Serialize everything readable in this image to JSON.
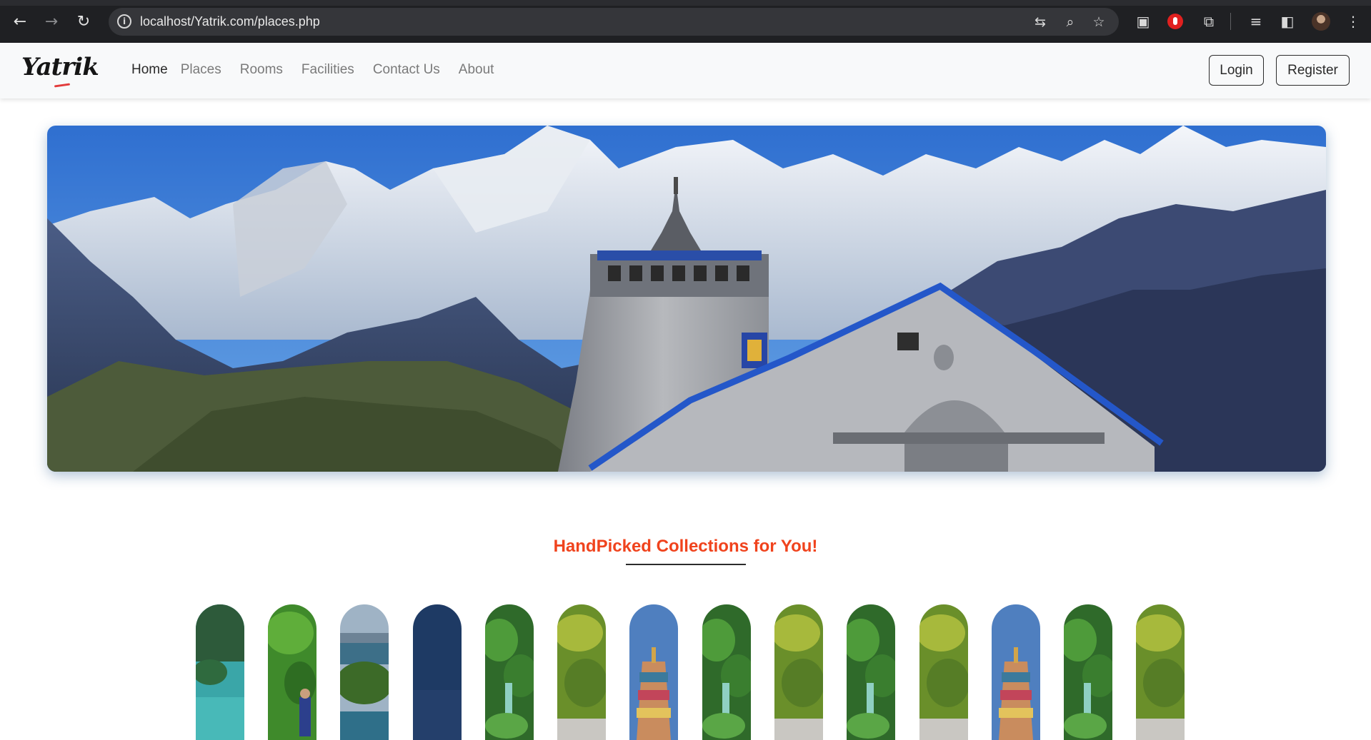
{
  "browser": {
    "url": "localhost/Yatrik.com/places.php",
    "icons": [
      "back-arrow-icon",
      "forward-arrow-icon",
      "reload-icon",
      "site-info-icon",
      "translate-icon",
      "zoom-icon",
      "bookmark-star-icon",
      "picture-in-picture-icon",
      "adblock-icon",
      "extensions-icon",
      "reading-list-icon",
      "side-panel-icon",
      "profile-avatar-icon",
      "menu-dots-icon"
    ]
  },
  "navbar": {
    "brand": "Yatrik",
    "links": [
      "Home",
      "Places",
      "Rooms",
      "Facilities",
      "Contact Us",
      "About"
    ],
    "login_label": "Login",
    "register_label": "Register"
  },
  "collections": {
    "title": "HandPicked Collections for You!",
    "title_color": "#f0431d",
    "thumbnails": [
      "island-lagoon",
      "zipline-jungle",
      "lake-islands",
      "blue-sky",
      "forest-waterfall",
      "green-canopy",
      "temple-gopuram",
      "forest-waterfall",
      "green-canopy",
      "forest-waterfall",
      "green-canopy",
      "temple-gopuram",
      "forest-waterfall",
      "green-canopy"
    ]
  }
}
